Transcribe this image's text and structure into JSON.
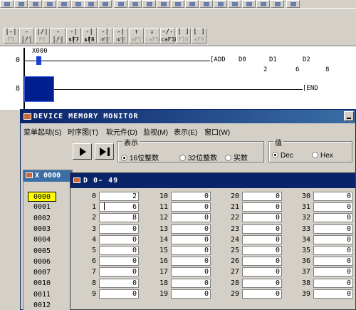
{
  "ladder": {
    "line_numbers": [
      "0",
      "8"
    ],
    "contact_label": "X000",
    "instruction": {
      "op": "[ADD",
      "a1": "D0",
      "a2": "D1",
      "a3": "D2"
    },
    "instruction_values": [
      "2",
      "6",
      "8"
    ],
    "end_label": "[END"
  },
  "fkeys": [
    {
      "sym": "|-|",
      "label": "F5",
      "on": false
    },
    {
      "sym": "-|/|",
      "label": "sF5",
      "on": false
    },
    {
      "sym": "|/|",
      "label": "F6",
      "on": false
    },
    {
      "sym": "-|/|",
      "label": "sF6",
      "on": false
    },
    {
      "sym": "-|↑|-",
      "label": "sF7",
      "on": true
    },
    {
      "sym": "-|↓|-",
      "label": "sF8",
      "on": true
    },
    {
      "sym": "-|↑|",
      "label": "aF7",
      "on": false
    },
    {
      "sym": "-|↓|",
      "label": "aF8",
      "on": false
    },
    {
      "sym": "↑",
      "label": "aF5",
      "on": false
    },
    {
      "sym": "↓",
      "label": "caF5",
      "on": false
    },
    {
      "sym": "-/-",
      "label": "caF10",
      "on": true
    },
    {
      "sym": "[ ]",
      "label": "F10",
      "on": false
    },
    {
      "sym": "[ ]",
      "label": "aF9",
      "on": false
    }
  ],
  "window": {
    "title": "DEVICE MEMORY MONITOR",
    "menus": [
      "菜单起动(S)",
      "时序图(T)",
      "软元件(D)",
      "监视(M)",
      "表示(E)",
      "窗口(W)"
    ],
    "display_group": "表示",
    "display_options": [
      "16位整数",
      "32位整数",
      "实数"
    ],
    "display_selected": 0,
    "value_group": "值",
    "value_options": [
      "Dec",
      "Hex"
    ],
    "value_selected": 0
  },
  "xwin": {
    "title": "X   0000",
    "rows": [
      "0000",
      "0001",
      "0002",
      "0003",
      "0004",
      "0005",
      "0006",
      "0007",
      "0010",
      "0011",
      "0012"
    ],
    "selected": 0
  },
  "dwin": {
    "title": "D   0- 49",
    "columns": [
      {
        "labels": [
          "0",
          "1",
          "2",
          "3",
          "4",
          "5",
          "6",
          "7",
          "8",
          "9"
        ],
        "values": [
          "2",
          "6",
          "8",
          "0",
          "0",
          "0",
          "0",
          "0",
          "0",
          "0"
        ]
      },
      {
        "labels": [
          "10",
          "11",
          "12",
          "13",
          "14",
          "15",
          "16",
          "17",
          "18",
          "19"
        ],
        "values": [
          "0",
          "0",
          "0",
          "0",
          "0",
          "0",
          "0",
          "0",
          "0",
          "0"
        ]
      },
      {
        "labels": [
          "20",
          "21",
          "22",
          "23",
          "24",
          "25",
          "26",
          "27",
          "28",
          "29"
        ],
        "values": [
          "0",
          "0",
          "0",
          "0",
          "0",
          "0",
          "0",
          "0",
          "0",
          "0"
        ]
      },
      {
        "labels": [
          "30",
          "31",
          "32",
          "33",
          "34",
          "35",
          "36",
          "37",
          "38",
          "39"
        ],
        "values": [
          "0",
          "0",
          "0",
          "0",
          "0",
          "0",
          "0",
          "0",
          "0",
          "0"
        ]
      }
    ]
  },
  "colors": {
    "title_active": "#0a246a",
    "selection": "#ffff00",
    "contact": "#1a3fd4"
  }
}
